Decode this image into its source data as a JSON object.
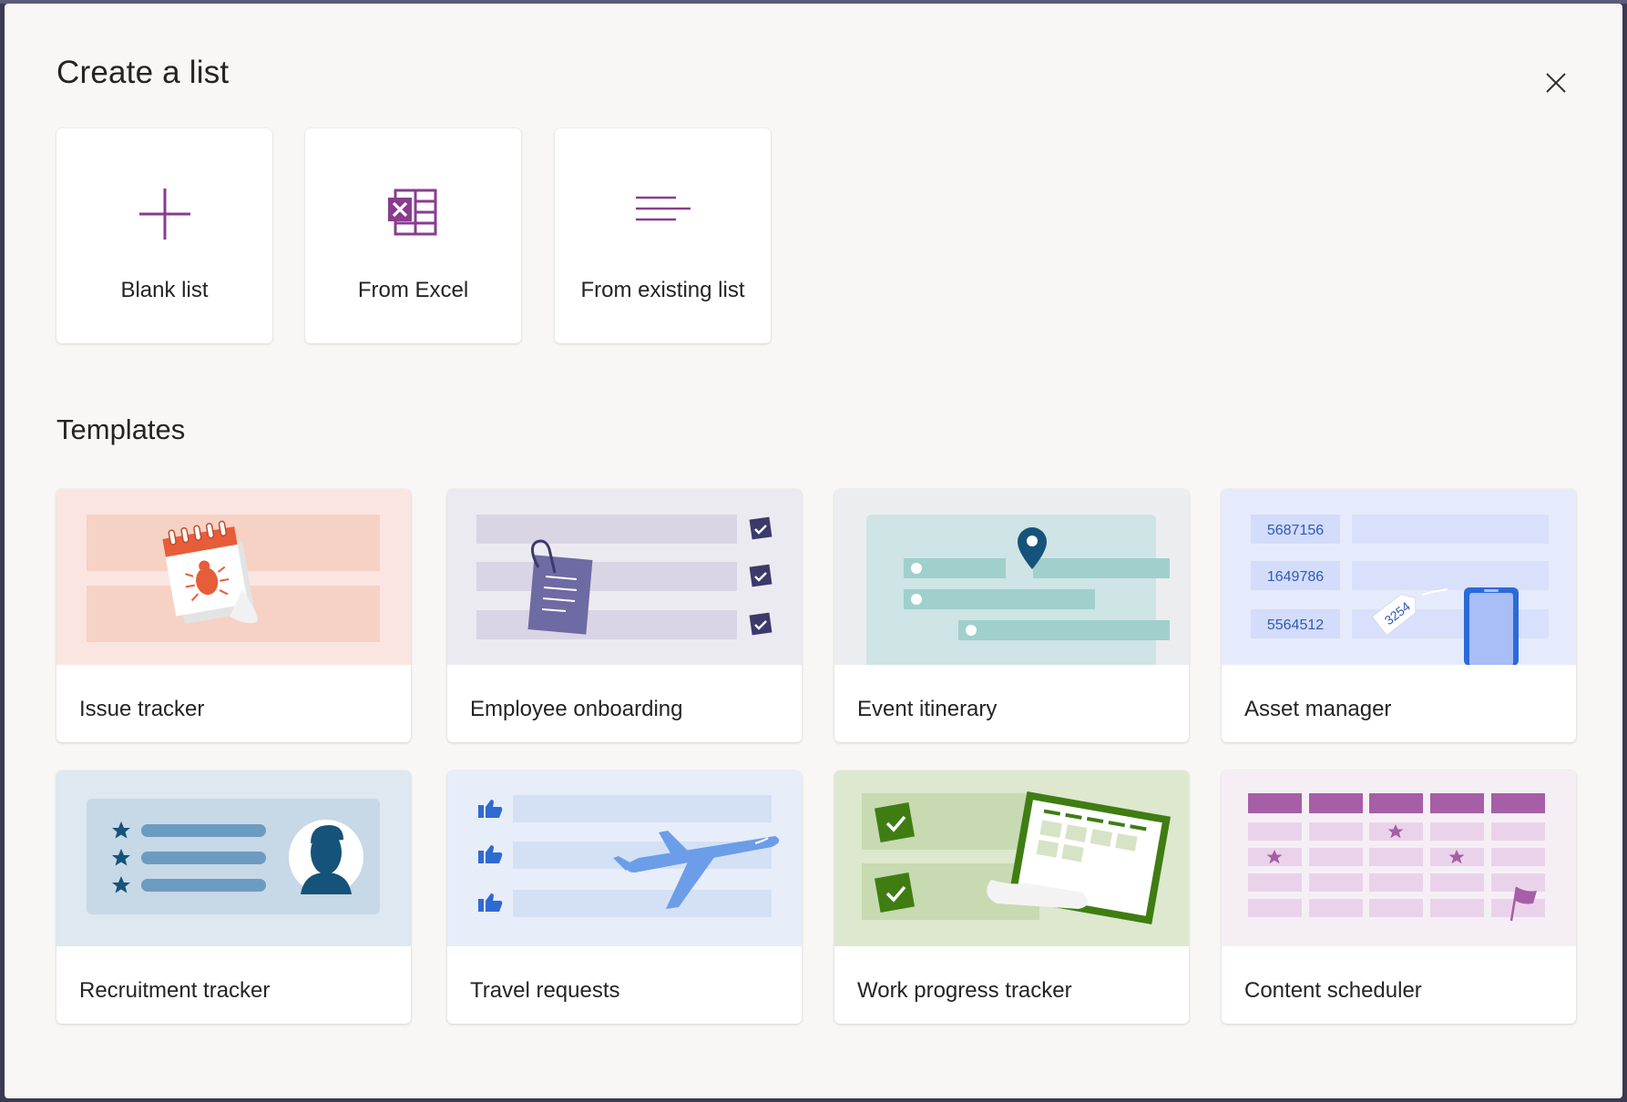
{
  "dialog": {
    "title": "Create a list",
    "close_icon": "close-icon"
  },
  "create_options": [
    {
      "label": "Blank list",
      "icon": "plus-icon"
    },
    {
      "label": "From Excel",
      "icon": "excel-icon"
    },
    {
      "label": "From existing list",
      "icon": "lines-icon"
    }
  ],
  "templates_section": {
    "title": "Templates",
    "items": [
      {
        "label": "Issue tracker",
        "art": "bug-calendar-illustration"
      },
      {
        "label": "Employee onboarding",
        "art": "clipboard-checklist-illustration"
      },
      {
        "label": "Event itinerary",
        "art": "map-pin-illustration"
      },
      {
        "label": "Asset manager",
        "art": "asset-tag-illustration",
        "asset_numbers": [
          "5687156",
          "1649786",
          "5564512"
        ],
        "tag_number": "3254"
      },
      {
        "label": "Recruitment tracker",
        "art": "candidate-profile-illustration"
      },
      {
        "label": "Travel requests",
        "art": "airplane-illustration"
      },
      {
        "label": "Work progress tracker",
        "art": "progress-calendar-illustration"
      },
      {
        "label": "Content scheduler",
        "art": "calendar-grid-illustration"
      }
    ]
  },
  "colors": {
    "accent": "#8a3c8f",
    "issue_bg": "#fbe5e1",
    "onboarding_bg": "#eceaf1",
    "itinerary_bg": "#ecedf1",
    "asset_bg": "#e6ebfb",
    "recruit_bg": "#dde8f0",
    "travel_bg": "#e8edfa",
    "work_bg": "#dde8cf",
    "content_bg": "#f5eff5"
  }
}
